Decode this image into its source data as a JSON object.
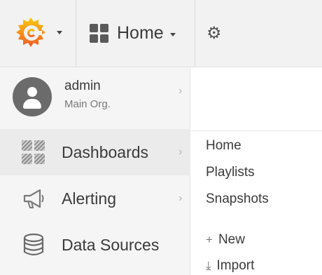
{
  "navbar": {
    "logo": "grafana-logo",
    "dashboard_title": "Home",
    "settings_icon": "gear-icon"
  },
  "profile": {
    "user": "admin",
    "org": "Main Org."
  },
  "sidemenu": {
    "items": [
      {
        "label": "Dashboards",
        "icon": "dashboards-grid-icon",
        "active": true
      },
      {
        "label": "Alerting",
        "icon": "megaphone-icon",
        "active": false
      },
      {
        "label": "Data Sources",
        "icon": "database-icon",
        "active": false
      }
    ]
  },
  "submenu": {
    "items": [
      {
        "label": "Home"
      },
      {
        "label": "Playlists"
      },
      {
        "label": "Snapshots"
      },
      {
        "label": "New",
        "icon": "plus-icon"
      },
      {
        "label": "Import",
        "icon": "download-icon"
      }
    ]
  },
  "colors": {
    "logo_orange": "#f05a28",
    "logo_yellow": "#fbca0a",
    "navbar_bg": "#f2f2f2",
    "sidemenu_bg": "#f5f5f5"
  }
}
